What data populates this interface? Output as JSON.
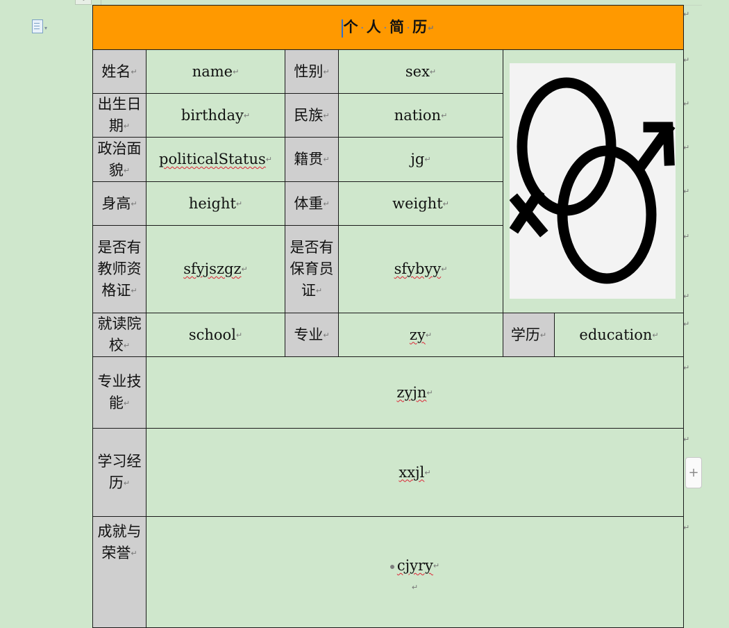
{
  "title": {
    "chars": [
      "个",
      "人",
      "简",
      "历"
    ]
  },
  "paragraph_mark": "↵",
  "add_row": "+",
  "ruler_marker": "⇩",
  "fields": {
    "name_label": "姓名",
    "name_value": "name",
    "sex_label": "性别",
    "sex_value": "sex",
    "birthday_label": "出生日期",
    "birthday_value": "birthday",
    "nation_label": "民族",
    "nation_value": "nation",
    "political_label": "政治面貌",
    "political_value": "politicalStatus",
    "jg_label": "籍贯",
    "jg_value": "jg",
    "height_label": "身高",
    "height_value": "height",
    "weight_label": "体重",
    "weight_value": "weight",
    "teacher_cert_label": "是否有教师资格证",
    "teacher_cert_value": "sfyjszgz",
    "nanny_cert_label": "是否有保育员证",
    "nanny_cert_value": "sfybyy",
    "school_label": "就读院校",
    "school_value": "school",
    "major_label": "专业",
    "major_value": "zy",
    "education_label": "学历",
    "education_value": "education",
    "skills_label": "专业技能",
    "skills_value": "zyjn",
    "study_label": "学习经历",
    "study_value": "xxjl",
    "honor_label": "成就与荣誉",
    "honor_value": "cjyry"
  },
  "icons": {
    "document": "document-icon",
    "photo": "gender-symbol-icon"
  },
  "colors": {
    "header": "#ff9900",
    "label_bg": "#cfcfcf",
    "page_bg": "#cfe7cc"
  }
}
